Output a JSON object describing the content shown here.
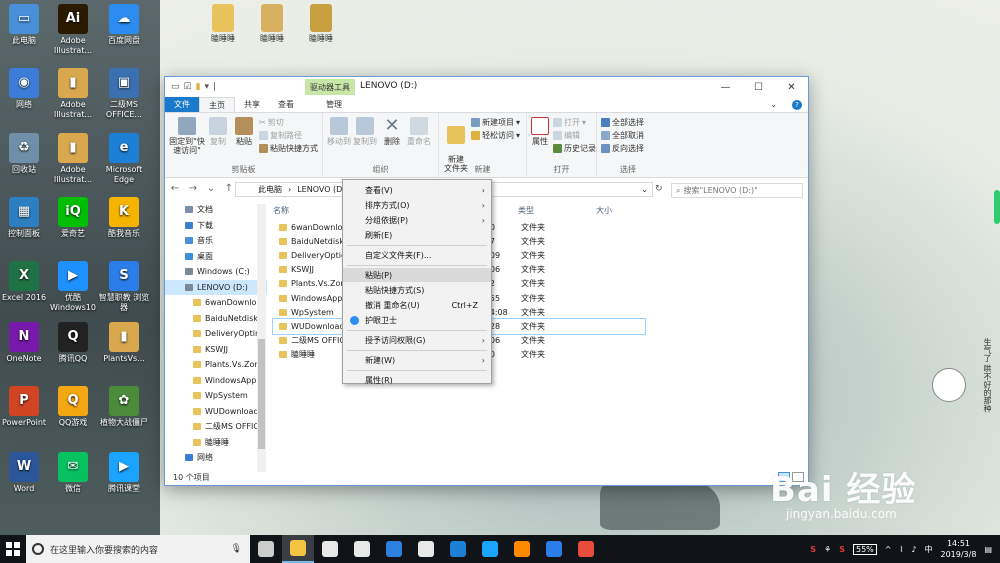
{
  "desktop": {
    "icons": [
      {
        "label": "此电脑",
        "color": "#4a90d9",
        "glyph": "▭"
      },
      {
        "label": "Adobe Illustrat...",
        "color": "#2b1a00",
        "glyph": "Ai"
      },
      {
        "label": "百度网盘",
        "color": "#2d8cf0",
        "glyph": "☁"
      },
      {
        "label": "网络",
        "color": "#3b7dd8",
        "glyph": "◉"
      },
      {
        "label": "Adobe Illustrat...",
        "color": "#d9a84e",
        "glyph": "▮"
      },
      {
        "label": "二级MS OFFICE...",
        "color": "#3a6fb0",
        "glyph": "▣"
      },
      {
        "label": "回收站",
        "color": "#6f8fa8",
        "glyph": "♻"
      },
      {
        "label": "Adobe Illustrat...",
        "color": "#d9a84e",
        "glyph": "▮"
      },
      {
        "label": "Microsoft Edge",
        "color": "#1e7fd6",
        "glyph": "e"
      },
      {
        "label": "控制面板",
        "color": "#2e7fc1",
        "glyph": "▦"
      },
      {
        "label": "爱奇艺",
        "color": "#00be06",
        "glyph": "iQ"
      },
      {
        "label": "酷我音乐",
        "color": "#f5b400",
        "glyph": "K"
      },
      {
        "label": "Excel 2016",
        "color": "#1f7244",
        "glyph": "X"
      },
      {
        "label": "优酷 Windows10",
        "color": "#1e90ff",
        "glyph": "▶"
      },
      {
        "label": "智慧职教 浏览器",
        "color": "#2b7de9",
        "glyph": "S"
      },
      {
        "label": "OneNote",
        "color": "#7719aa",
        "glyph": "N"
      },
      {
        "label": "腾讯QQ",
        "color": "#222",
        "glyph": "Q"
      },
      {
        "label": "PlantsVs...",
        "color": "#d9a84e",
        "glyph": "▮"
      },
      {
        "label": "PowerPoint",
        "color": "#d04423",
        "glyph": "P"
      },
      {
        "label": "QQ游戏",
        "color": "#f3a712",
        "glyph": "Q"
      },
      {
        "label": "植物大战僵尸",
        "color": "#4a8c3a",
        "glyph": "✿"
      },
      {
        "label": "Word",
        "color": "#2b579a",
        "glyph": "W"
      },
      {
        "label": "微信",
        "color": "#07c160",
        "glyph": "✉"
      },
      {
        "label": "腾讯课堂",
        "color": "#1aa3ff",
        "glyph": "▶"
      }
    ],
    "top_icons": [
      "瞌睡睡",
      "瞌睡睡",
      "瞌睡睡"
    ]
  },
  "window": {
    "title": "LENOVO (D:)",
    "context_tab": "驱动器工具",
    "controls": [
      "—",
      "☐",
      "✕"
    ],
    "tabs": [
      "文件",
      "主页",
      "共享",
      "查看",
      "管理"
    ],
    "ribbon": {
      "clipboard": {
        "pin_label": "固定到\"快速访问\"",
        "copy_label": "复制",
        "paste_label": "粘贴",
        "cut_label": "剪切",
        "copy_path_label": "复制路径",
        "paste_shortcut_label": "粘贴快捷方式",
        "group": "剪贴板"
      },
      "organize": {
        "move_label": "移动到",
        "copy_to_label": "复制到",
        "delete_label": "删除",
        "rename_label": "重命名",
        "group": "组织"
      },
      "new": {
        "new_folder_label": "新建\n文件夹",
        "new_item_label": "新建项目",
        "easy_access_label": "轻松访问",
        "group": "新建"
      },
      "open": {
        "properties_label": "属性",
        "open_label": "打开",
        "edit_label": "编辑",
        "history_label": "历史记录",
        "group": "打开"
      },
      "select": {
        "select_all": "全部选择",
        "select_none": "全部取消",
        "invert": "反向选择",
        "group": "选择"
      }
    },
    "address": {
      "path": [
        "此电脑",
        "LENOVO (D:)"
      ],
      "search_placeholder": "搜索\"LENOVO (D:)\""
    },
    "nav_items": [
      {
        "label": "文档",
        "type": "doc"
      },
      {
        "label": "下载",
        "type": "download"
      },
      {
        "label": "音乐",
        "type": "music"
      },
      {
        "label": "桌面",
        "type": "desktop"
      },
      {
        "label": "Windows (C:)",
        "type": "drive"
      },
      {
        "label": "LENOVO (D:)",
        "type": "drive",
        "selected": true
      },
      {
        "label": "6wanDownlo",
        "type": "folder"
      },
      {
        "label": "BaiduNetdisk",
        "type": "folder"
      },
      {
        "label": "DeliveryOptin",
        "type": "folder"
      },
      {
        "label": "KSWJJ",
        "type": "folder"
      },
      {
        "label": "Plants.Vs.Zom",
        "type": "folder"
      },
      {
        "label": "WindowsApp",
        "type": "folder"
      },
      {
        "label": "WpSystem",
        "type": "folder"
      },
      {
        "label": "WUDownload",
        "type": "folder"
      },
      {
        "label": "二级MS OFFIC",
        "type": "folder"
      },
      {
        "label": "瞌睡睡",
        "type": "folder"
      },
      {
        "label": "网络",
        "type": "network"
      }
    ],
    "columns": [
      "名称",
      "类型",
      "大小"
    ],
    "files": [
      {
        "name": "6wanDownlo",
        "time": "4:50",
        "type": "文件夹"
      },
      {
        "name": "BaiduNetdisk",
        "time": "7:37",
        "type": "文件夹"
      },
      {
        "name": "DeliveryOptic",
        "time": "21:09",
        "type": "文件夹"
      },
      {
        "name": "KSWJJ",
        "time": "18:06",
        "type": "文件夹"
      },
      {
        "name": "Plants.Vs.Zon",
        "time": "9:32",
        "type": "文件夹"
      },
      {
        "name": "WindowsApp",
        "time": "18:55",
        "type": "文件夹"
      },
      {
        "name": "WpSystem",
        "time": "3 14:08",
        "type": "文件夹"
      },
      {
        "name": "WUDownload",
        "time": "20:28",
        "type": "文件夹",
        "highlight": true
      },
      {
        "name": "二级MS OFFIC",
        "time": "18:06",
        "type": "文件夹"
      },
      {
        "name": "瞌睡睡",
        "time": "2:50",
        "type": "文件夹"
      }
    ],
    "status": "10 个项目"
  },
  "context_menu": [
    {
      "label": "查看(V)",
      "arrow": true
    },
    {
      "label": "排序方式(O)",
      "arrow": true
    },
    {
      "label": "分组依据(P)",
      "arrow": true
    },
    {
      "label": "刷新(E)"
    },
    {
      "sep": true
    },
    {
      "label": "自定义文件夹(F)..."
    },
    {
      "sep": true
    },
    {
      "label": "粘贴(P)",
      "hover": true
    },
    {
      "label": "粘贴快捷方式(S)"
    },
    {
      "label": "撤消 重命名(U)",
      "shortcut": "Ctrl+Z"
    },
    {
      "label": "护眼卫士",
      "icon": true
    },
    {
      "sep": true
    },
    {
      "label": "授予访问权限(G)",
      "arrow": true
    },
    {
      "sep": true
    },
    {
      "label": "新建(W)",
      "arrow": true
    },
    {
      "sep": true
    },
    {
      "label": "属性(R)"
    }
  ],
  "taskbar": {
    "search_placeholder": "在这里输入你要搜索的内容",
    "apps": [
      {
        "name": "task-view",
        "color": "#ccc"
      },
      {
        "name": "file-explorer",
        "color": "#f4c542",
        "active": true
      },
      {
        "name": "store",
        "color": "#e8e8e8"
      },
      {
        "name": "mail",
        "color": "#e8e8e8"
      },
      {
        "name": "clock-app",
        "color": "#2d7fe0"
      },
      {
        "name": "settings",
        "color": "#e8e8e8"
      },
      {
        "name": "edge",
        "color": "#1e7fd6"
      },
      {
        "name": "q-browser",
        "color": "#1aa3ff"
      },
      {
        "name": "illustrator",
        "color": "#ff8a00"
      },
      {
        "name": "zhijiao",
        "color": "#2b7de9"
      },
      {
        "name": "chrome",
        "color": "#e84c3d"
      }
    ],
    "battery": "55%",
    "ime": "中",
    "time": "14:51",
    "date": "2019/3/8"
  },
  "watermark": {
    "brand": "Bai  经验",
    "url": "jingyan.baidu.com"
  },
  "cartoon_text": "生气了 哄不好的那种"
}
